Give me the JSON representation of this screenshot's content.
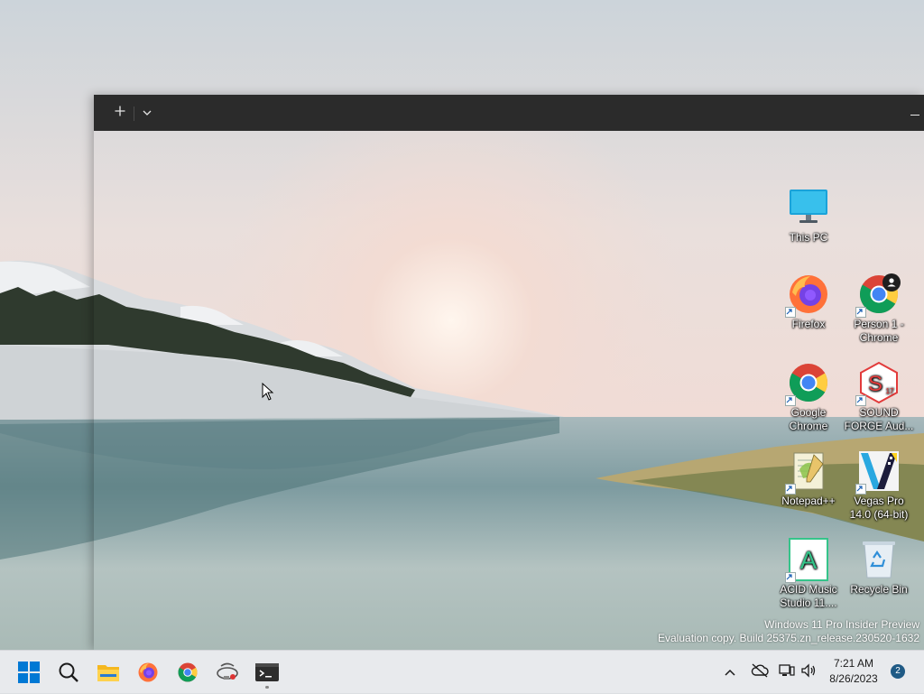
{
  "terminal": {
    "new_tab_icon": "plus-icon",
    "dropdown_icon": "chevron-down-icon",
    "minimize_icon": "minimize-icon"
  },
  "desktop": {
    "icons": [
      {
        "label": "This PC",
        "icon": "monitor-icon"
      },
      {
        "label": "Firefox",
        "icon": "firefox-icon"
      },
      {
        "label": "Person 1 - Chrome",
        "icon": "chrome-profile-icon"
      },
      {
        "label": "Google Chrome",
        "icon": "chrome-icon"
      },
      {
        "label": "SOUND FORGE Aud...",
        "icon": "sound-forge-icon"
      },
      {
        "label": "Notepad++",
        "icon": "notepadpp-icon"
      },
      {
        "label": "Vegas Pro 14.0 (64-bit)",
        "icon": "vegas-pro-icon"
      },
      {
        "label": "ACID Music Studio 11....",
        "icon": "acid-icon"
      },
      {
        "label": "Recycle Bin",
        "icon": "recycle-bin-icon"
      }
    ],
    "sound_forge_badge": "17",
    "acid_letter": "A"
  },
  "watermark": {
    "line1": "Windows 11 Pro Insider Preview",
    "line2": "Evaluation copy. Build 25375.zn_release.230520-1632"
  },
  "taskbar": {
    "apps": [
      {
        "name": "Start",
        "icon": "windows-logo-icon"
      },
      {
        "name": "Search",
        "icon": "search-icon"
      },
      {
        "name": "File Explorer",
        "icon": "folder-icon"
      },
      {
        "name": "Firefox",
        "icon": "firefox-icon"
      },
      {
        "name": "Google Chrome",
        "icon": "chrome-icon"
      },
      {
        "name": "Network tool",
        "icon": "network-tool-icon"
      },
      {
        "name": "Terminal",
        "icon": "terminal-icon"
      }
    ],
    "tray": {
      "time": "7:21 AM",
      "date": "8/26/2023",
      "notification_count": "2"
    }
  },
  "colors": {
    "titlebar": "#2b2b2b",
    "taskbar": "#e8eaed",
    "accent": "#0078d4",
    "notification_badge": "#1f5a85"
  }
}
